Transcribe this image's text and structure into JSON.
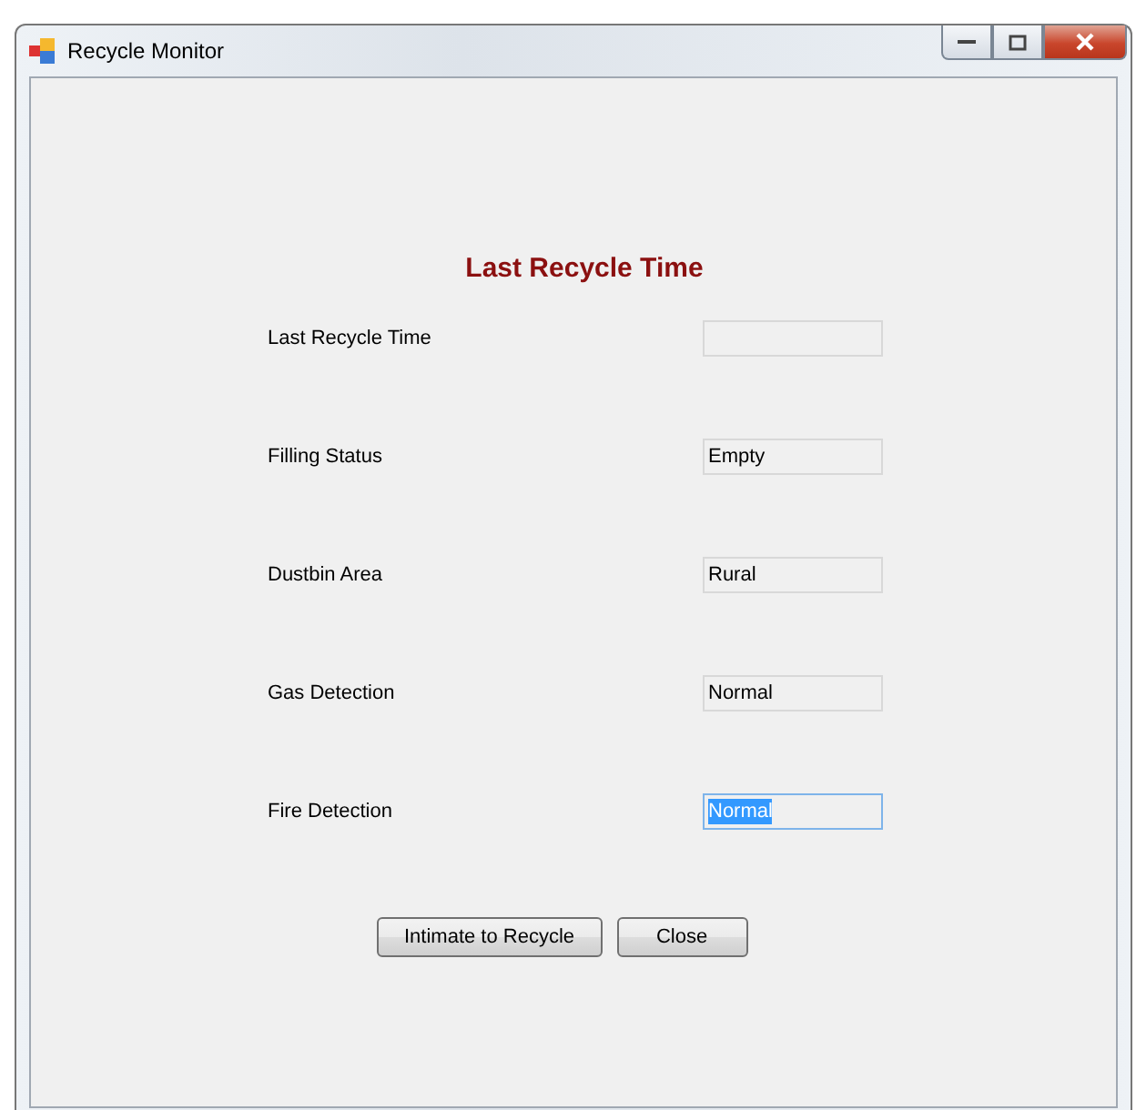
{
  "window": {
    "title": "Recycle Monitor"
  },
  "heading": "Last Recycle Time",
  "fields": [
    {
      "label": "Last Recycle Time",
      "focused": false
    },
    {
      "label": "Filling Status",
      "value": "Empty",
      "focused": false
    },
    {
      "label": "Dustbin Area",
      "value": "Rural",
      "focused": false
    },
    {
      "label": "Gas Detection",
      "value": "Normal",
      "focused": false
    },
    {
      "label": "Fire Detection",
      "value": "Normal",
      "focused": true
    }
  ],
  "buttons": [
    "Intimate to Recycle",
    "Close"
  ]
}
